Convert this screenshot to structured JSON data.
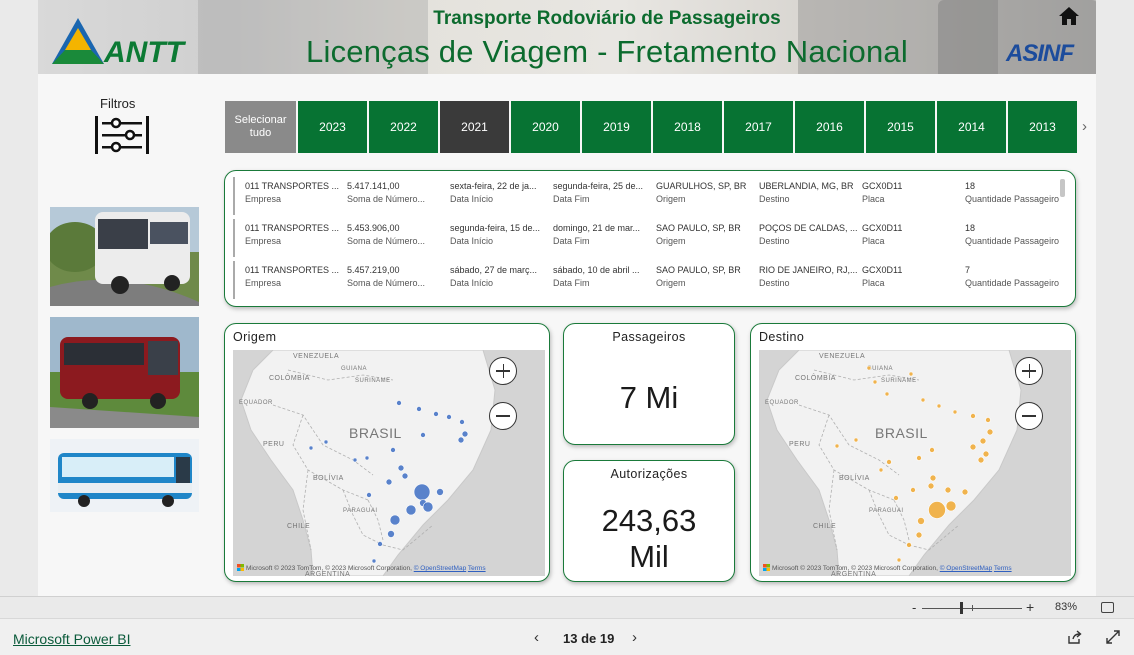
{
  "header": {
    "subtitle": "Transporte Rodoviário de Passageiros",
    "title": "Licenças de Viagem - Fretamento Nacional",
    "logo_left_text": "ANTT",
    "logo_right_text": "ASINF",
    "home_icon": "home-icon"
  },
  "filters": {
    "label": "Filtros",
    "icon": "sliders-icon"
  },
  "year_slicer": {
    "select_all_label": "Selecionar tudo",
    "years": [
      "2023",
      "2022",
      "2021",
      "2020",
      "2019",
      "2018",
      "2017",
      "2016",
      "2015",
      "2014",
      "2013"
    ],
    "selected": "2021",
    "colors": {
      "default": "#077333",
      "selected": "#3a3a3a",
      "select_all": "#8a8a8a"
    }
  },
  "table": {
    "rows": [
      [
        {
          "value": "011 TRANSPORTES ...",
          "label": "Empresa"
        },
        {
          "value": "5.417.141,00",
          "label": "Soma de Número..."
        },
        {
          "value": "sexta-feira, 22 de ja...",
          "label": "Data Início"
        },
        {
          "value": "segunda-feira, 25 de...",
          "label": "Data Fim"
        },
        {
          "value": "GUARULHOS, SP, BR",
          "label": "Origem"
        },
        {
          "value": "UBERLANDIA, MG, BR",
          "label": "Destino"
        },
        {
          "value": "GCX0D11",
          "label": "Placa"
        },
        {
          "value": "18",
          "label": "Quantidade Passageiro"
        }
      ],
      [
        {
          "value": "011 TRANSPORTES ...",
          "label": "Empresa"
        },
        {
          "value": "5.453.906,00",
          "label": "Soma de Número..."
        },
        {
          "value": "segunda-feira, 15 de...",
          "label": "Data Início"
        },
        {
          "value": "domingo, 21 de mar...",
          "label": "Data Fim"
        },
        {
          "value": "SAO PAULO, SP, BR",
          "label": "Origem"
        },
        {
          "value": "POÇOS DE CALDAS, ...",
          "label": "Destino"
        },
        {
          "value": "GCX0D11",
          "label": "Placa"
        },
        {
          "value": "18",
          "label": "Quantidade Passageiro"
        }
      ],
      [
        {
          "value": "011 TRANSPORTES ...",
          "label": "Empresa"
        },
        {
          "value": "5.457.219,00",
          "label": "Soma de Número..."
        },
        {
          "value": "sábado, 27 de març...",
          "label": "Data Início"
        },
        {
          "value": "sábado, 10 de abril ...",
          "label": "Data Fim"
        },
        {
          "value": "SAO PAULO, SP, BR",
          "label": "Origem"
        },
        {
          "value": "RIO DE JANEIRO, RJ,...",
          "label": "Destino"
        },
        {
          "value": "GCX0D11",
          "label": "Placa"
        },
        {
          "value": "7",
          "label": "Quantidade Passageiro"
        }
      ]
    ]
  },
  "map_labels": {
    "venezuela": "VENEZUELA",
    "guiana": "GUIANA",
    "suriname": "SURINAME",
    "colombia": "COLÔMBIA",
    "equador": "EQUADOR",
    "peru": "PERU",
    "brasil": "BRASIL",
    "bolivia": "BOLÍVIA",
    "paraguai": "PARAGUAI",
    "chile": "CHILE",
    "argentina": "ARGENTINA"
  },
  "map_credit": {
    "text": "Microsoft © 2023 TomTom, © 2023 Microsoft Corporation,",
    "osm": "© OpenStreetMap",
    "terms": "Terms"
  },
  "origem_map": {
    "title": "Origem",
    "dot_color": "#3e6fc4"
  },
  "destino_map": {
    "title": "Destino",
    "dot_color": "#f0a830"
  },
  "kpis": {
    "passageiros": {
      "title": "Passageiros",
      "value": "7 Mi"
    },
    "autorizacoes": {
      "title": "Autorizações",
      "value_line1": "243,63",
      "value_line2": "Mil"
    }
  },
  "zoom": {
    "level": "83%",
    "minus": "-",
    "plus": "+"
  },
  "footer": {
    "app_link": "Microsoft Power BI",
    "page_indicator": "13 de 19"
  }
}
